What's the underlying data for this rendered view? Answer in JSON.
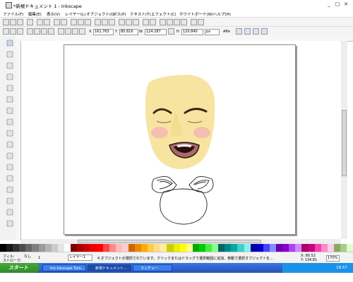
{
  "window": {
    "title": "*新規ドキュメント 1 - Inkscape",
    "minimize": "_",
    "maximize": "□",
    "close": "✕"
  },
  "menu": [
    "ファイル(F)",
    "編集(E)",
    "表示(V)",
    "レイヤー(L)",
    "オブジェクト(O)",
    "パス(P)",
    "テキスト(T)",
    "エフェクト(C)",
    "ホワイトボード(W)",
    "ヘルプ(H)"
  ],
  "controls": {
    "x_label": "X",
    "x_value": "161.763",
    "y_label": "Y",
    "y_value": "80.816",
    "w_label": "W",
    "w_value": "124.287",
    "h_label": "H",
    "h_value": "120.840",
    "unit": "px",
    "affect": "Affe"
  },
  "status": {
    "fill_label": "フィル:",
    "stroke_label": "ストローク:",
    "fill_value": "なし",
    "opacity": "1",
    "layer": "レイヤー1",
    "message": "4 オブジェクトが選択されています。クリックまたはドラッグで選択範囲に追加、移動で選択オブジェクトを...",
    "x_readout": "X: 80.52",
    "y_readout": "Y: 134.81",
    "zoom": "170%"
  },
  "taskbar": {
    "start": "スタート",
    "items": [
      "tlio Inkscape Tuto...",
      "新規ドキュメント...",
      "ランチャー"
    ],
    "clock": "18:57"
  },
  "colors": {
    "face": "#f7e4a0",
    "blush": "#f3b4b4",
    "lips": "#a86a6a",
    "taskbar": "#2a5ed0"
  },
  "tools": [
    "select-arrow-icon",
    "node-edit-icon",
    "tweak-icon",
    "zoom-icon",
    "rectangle-icon",
    "3d-box-icon",
    "ellipse-icon",
    "star-icon",
    "spiral-icon",
    "pencil-icon",
    "pen-icon",
    "calligraphy-icon",
    "text-icon",
    "spray-icon",
    "bucket-fill-icon",
    "gradient-icon",
    "dropper-icon"
  ]
}
